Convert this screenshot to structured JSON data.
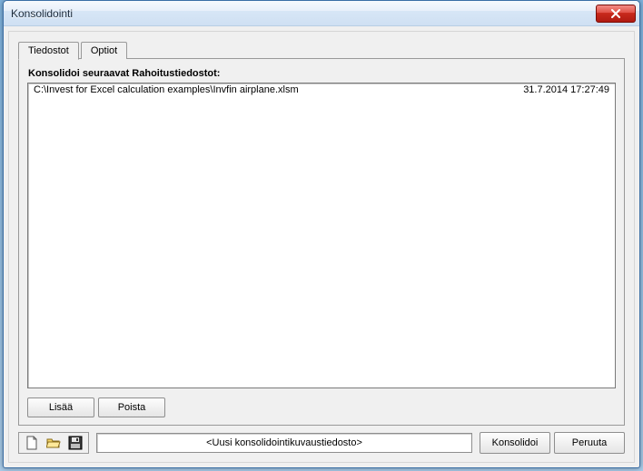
{
  "window": {
    "title": "Konsolidointi"
  },
  "tabs": {
    "files": "Tiedostot",
    "options": "Optiot"
  },
  "panel": {
    "heading": "Konsolidoi seuraavat Rahoitustiedostot:"
  },
  "files": [
    {
      "path": "C:\\Invest for Excel calculation examples\\Invfin airplane.xlsm",
      "timestamp": "31.7.2014 17:27:49"
    }
  ],
  "buttons": {
    "add": "Lisää",
    "remove": "Poista",
    "consolidate": "Konsolidoi",
    "cancel": "Peruuta"
  },
  "descFile": "<Uusi konsolidointikuvaustiedosto>",
  "icons": {
    "new": "new-file-icon",
    "open": "open-folder-icon",
    "save": "save-disk-icon"
  }
}
